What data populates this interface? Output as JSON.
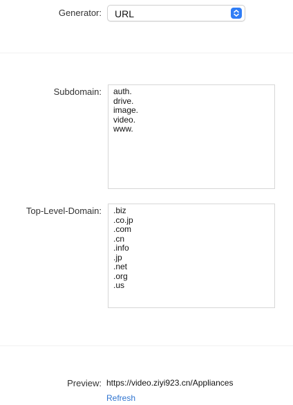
{
  "generator": {
    "label": "Generator:",
    "selected": "URL"
  },
  "subdomain": {
    "label": "Subdomain:",
    "items": [
      "auth.",
      "drive.",
      "image.",
      "video.",
      "www."
    ]
  },
  "tld": {
    "label": "Top-Level-Domain:",
    "items": [
      ".biz",
      ".co.jp",
      ".com",
      ".cn",
      ".info",
      ".jp",
      ".net",
      ".org",
      ".us"
    ]
  },
  "preview": {
    "label": "Preview:",
    "value": "https://video.ziyi923.cn/Appliances",
    "refresh_label": "Refresh"
  },
  "colors": {
    "accent": "#2f7df6",
    "link": "#2f74d0",
    "border": "#d6d6d6"
  }
}
